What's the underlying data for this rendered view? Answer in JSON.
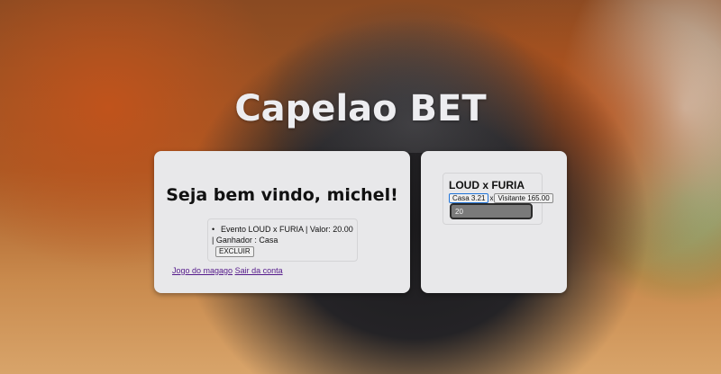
{
  "app": {
    "title": "Capelao BET"
  },
  "user_panel": {
    "welcome": "Seja bem vindo, michel!",
    "bets": [
      {
        "text": "Evento LOUD x FURIA | Valor: 20.00 | Ganhador : Casa",
        "delete_label": "EXCLUIR"
      }
    ],
    "links": {
      "game": "Jogo do magago",
      "logout": "Sair da conta"
    }
  },
  "event_panel": {
    "event_title": "LOUD x FURIA",
    "home_odd_label": "Casa 3.21",
    "separator": "x",
    "away_odd_label": "Visitante 165.00",
    "amount_value": "20"
  }
}
